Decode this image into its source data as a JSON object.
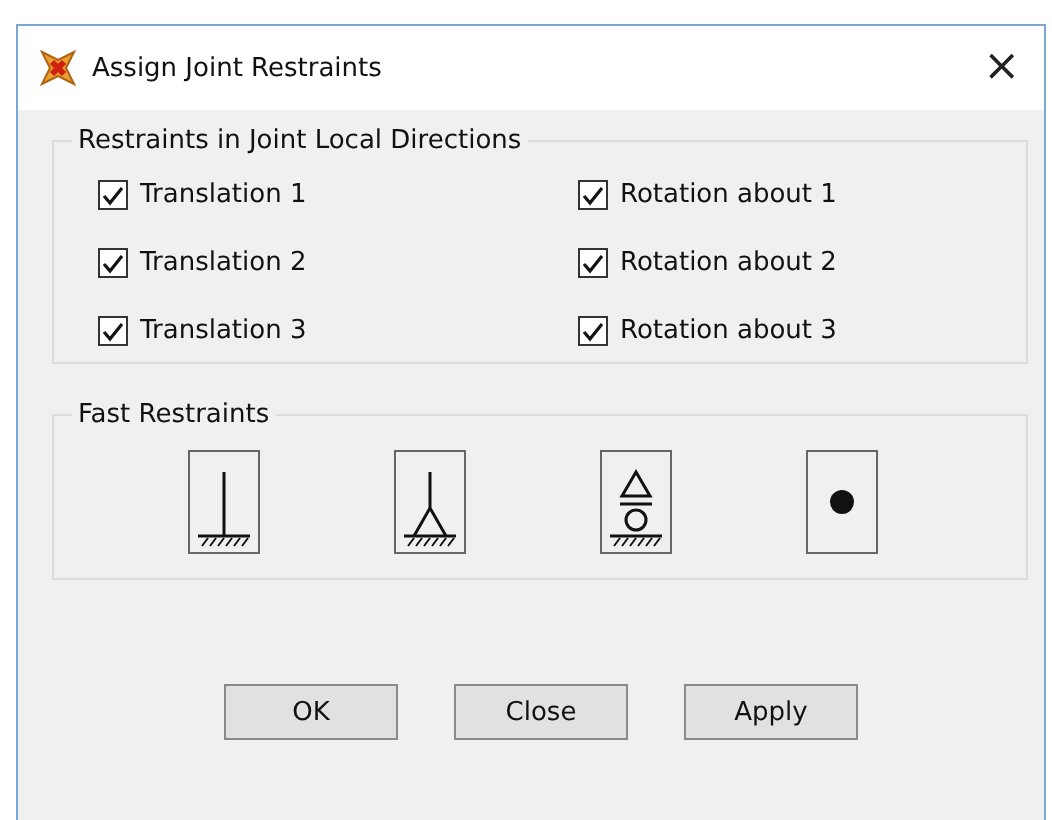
{
  "window": {
    "title": "Assign Joint Restraints",
    "close": "×"
  },
  "restraints_group": {
    "title": "Restraints in Joint Local Directions",
    "checkboxes": [
      {
        "label": "Translation 1",
        "checked": true
      },
      {
        "label": "Rotation about 1",
        "checked": true
      },
      {
        "label": "Translation 2",
        "checked": true
      },
      {
        "label": "Rotation about 2",
        "checked": true
      },
      {
        "label": "Translation 3",
        "checked": true
      },
      {
        "label": "Rotation about 3",
        "checked": true
      }
    ]
  },
  "fast_restraints": {
    "title": "Fast Restraints",
    "buttons": [
      {
        "kind": "fixed"
      },
      {
        "kind": "pinned"
      },
      {
        "kind": "roller"
      },
      {
        "kind": "free"
      }
    ]
  },
  "buttons": [
    "OK",
    "Close",
    "Apply"
  ]
}
